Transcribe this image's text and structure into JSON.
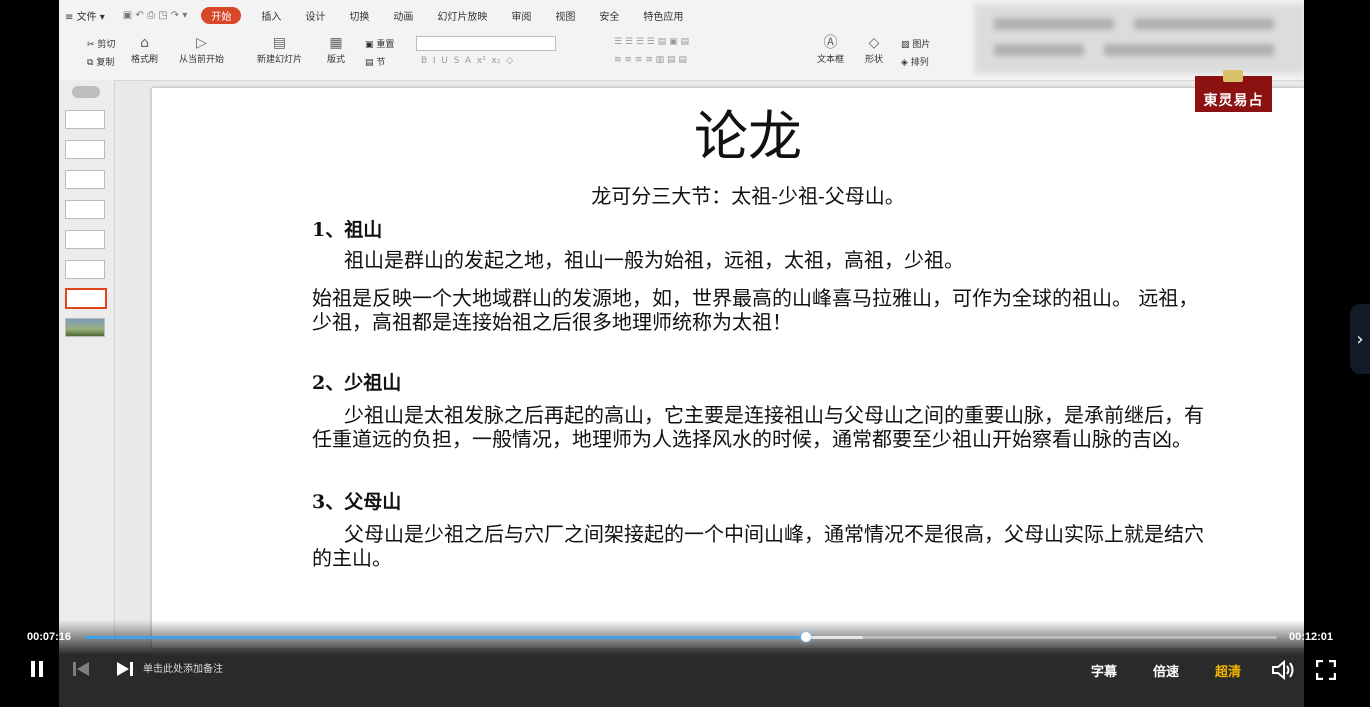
{
  "ribbon": {
    "file": "文件",
    "menu_tabs": [
      "开始",
      "插入",
      "设计",
      "切换",
      "动画",
      "幻灯片放映",
      "审阅",
      "视图",
      "安全",
      "特色应用"
    ],
    "cut": "剪切",
    "copy": "复制",
    "format_painter": "格式刷",
    "from_current": "从当前开始",
    "new_slide": "新建幻灯片",
    "layout": "版式",
    "reset": "重置",
    "section": "节",
    "textbox": "文本框",
    "shape": "形状",
    "picture": "图片",
    "arrange": "排列"
  },
  "slide": {
    "title": "论龙",
    "subtitle": "龙可分三大节：太祖-少祖-父母山。",
    "sections": [
      {
        "heading": "1、祖山",
        "para1": "祖山是群山的发起之地，祖山一般为始祖，远祖，太祖，高祖，少祖。",
        "para2": "始祖是反映一个大地域群山的发源地，如，世界最高的山峰喜马拉雅山，可作为全球的祖山。 远祖，少祖，高祖都是连接始祖之后很多地理师统称为太祖！"
      },
      {
        "heading": "2、少祖山",
        "para1": "少祖山是太祖发脉之后再起的高山，它主要是连接祖山与父母山之间的重要山脉，是承前继后，有任重道远的负担，一般情况，地理师为人选择风水的时候，通常都要至少祖山开始察看山脉的吉凶。"
      },
      {
        "heading": "3、父母山",
        "para1": "父母山是少祖之后与穴厂之间架接起的一个中间山峰，通常情况不是很高，父母山实际上就是结穴的主山。"
      }
    ],
    "logo_text": "東灵易占"
  },
  "notes_placeholder": "单击此处添加备注",
  "player": {
    "current_time": "00:07:16",
    "total_time": "00:12:01",
    "progress": 0.605,
    "buffered": 0.653,
    "subtitle_btn": "字幕",
    "speed_btn": "倍速",
    "quality_btn": "超清",
    "accent_color": "#3fa2e8",
    "quality_color": "#f5b400"
  }
}
